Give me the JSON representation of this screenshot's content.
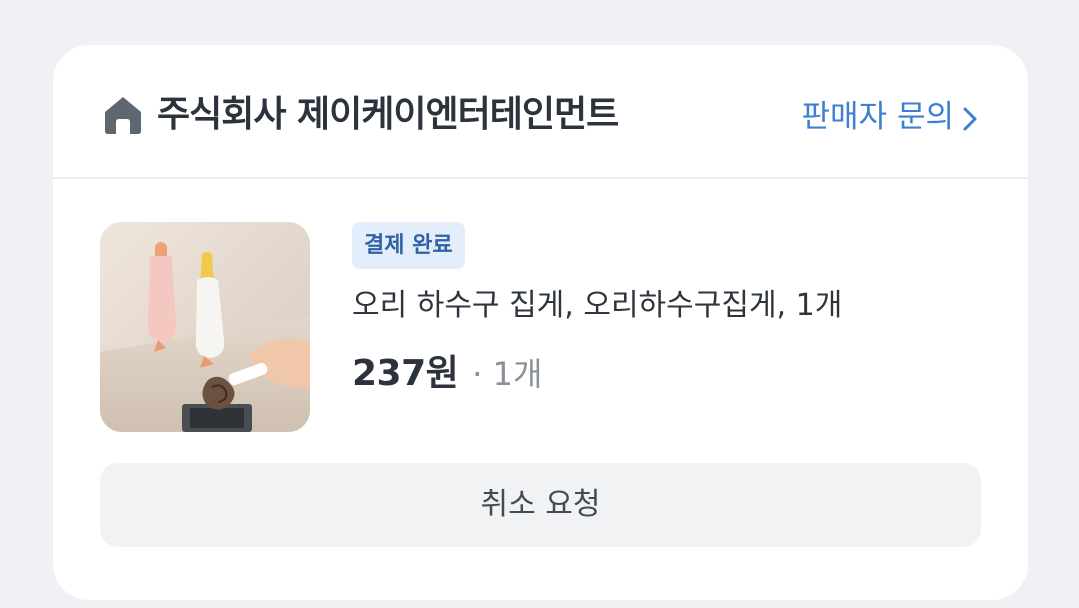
{
  "order": {
    "store": {
      "icon": "home-icon",
      "name": "주식회사 제이케이엔터테인먼트",
      "seller_inquiry_label": "판매자 문의",
      "link_icon": "chevron-right-icon"
    },
    "item": {
      "thumbnail": "duck-drain-hair-catcher-photo",
      "status_badge": "결제 완료",
      "name": "오리 하수구 집게, 오리하수구집게, 1개",
      "price": "237원",
      "quantity": "· 1개"
    },
    "actions": {
      "cancel_request_label": "취소 요청"
    }
  },
  "colors": {
    "background": "#eff1f4",
    "card": "#ffffff",
    "link_blue": "#3d7fd0",
    "badge_bg": "#e4eefb",
    "badge_text": "#2f63a8",
    "button_bg": "#f1f2f4"
  }
}
